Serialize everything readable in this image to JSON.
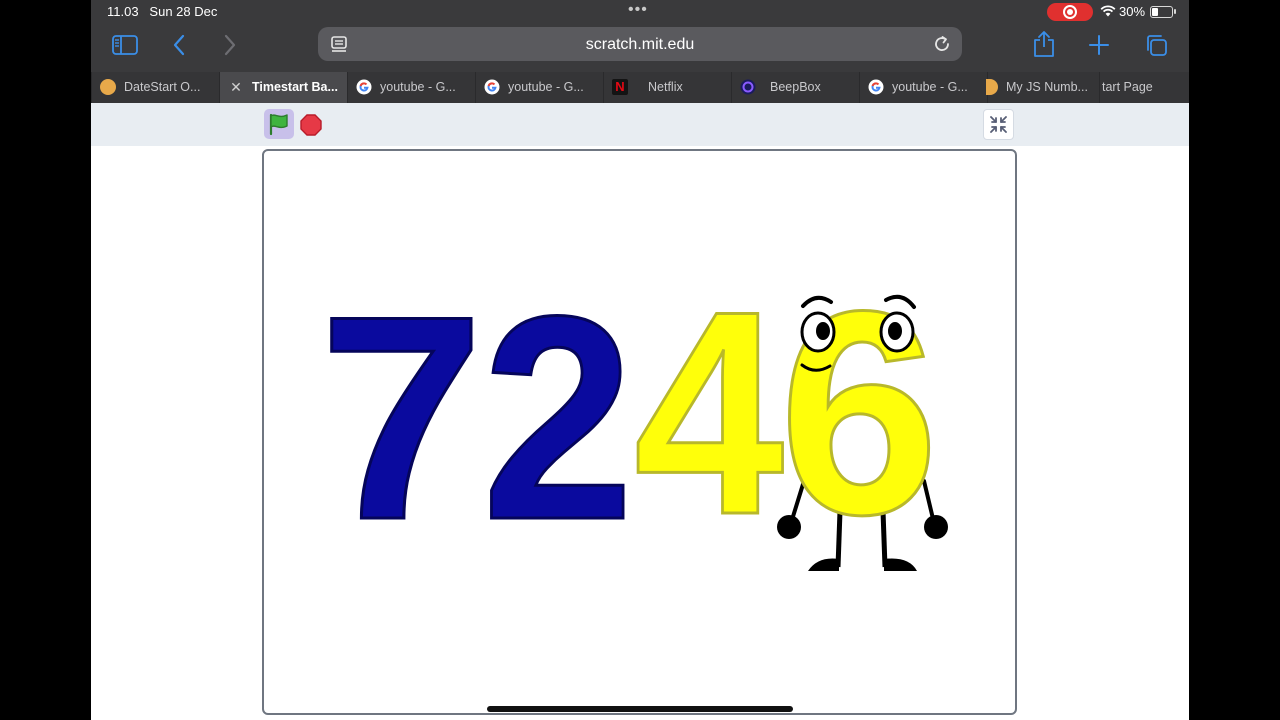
{
  "status_bar": {
    "time": "11.03",
    "date": "Sun 28 Dec",
    "battery": "30%"
  },
  "toolbar": {
    "url": "scratch.mit.edu"
  },
  "tabs": [
    {
      "label": "DateStart O...",
      "icon": "blank-favicon",
      "active": false
    },
    {
      "label": "Timestart Ba...",
      "icon": "close-icon",
      "active": true
    },
    {
      "label": "youtube - G...",
      "icon": "google-favicon",
      "active": false
    },
    {
      "label": "youtube - G...",
      "icon": "google-favicon",
      "active": false
    },
    {
      "label": "Netflix",
      "icon": "netflix-favicon",
      "active": false
    },
    {
      "label": "BeepBox",
      "icon": "beepbox-favicon",
      "active": false
    },
    {
      "label": "youtube - G...",
      "icon": "google-favicon",
      "active": false
    },
    {
      "label": "My JS Numb...",
      "icon": "blank-favicon",
      "active": false
    },
    {
      "label": "tart Page",
      "icon": "none",
      "active": false
    }
  ],
  "stage": {
    "digits": [
      "7",
      "2",
      "4",
      "6"
    ],
    "colors": {
      "blue_digit": "#0a0a9e",
      "yellow_digit": "#ffff0a",
      "yellow_outline": "#b8b82a"
    }
  },
  "colors": {
    "chrome": "#3a3a3c",
    "accent": "#3a8ee8",
    "record": "#e0302f",
    "stop": "#e63946",
    "flag": "#3fb43f"
  }
}
